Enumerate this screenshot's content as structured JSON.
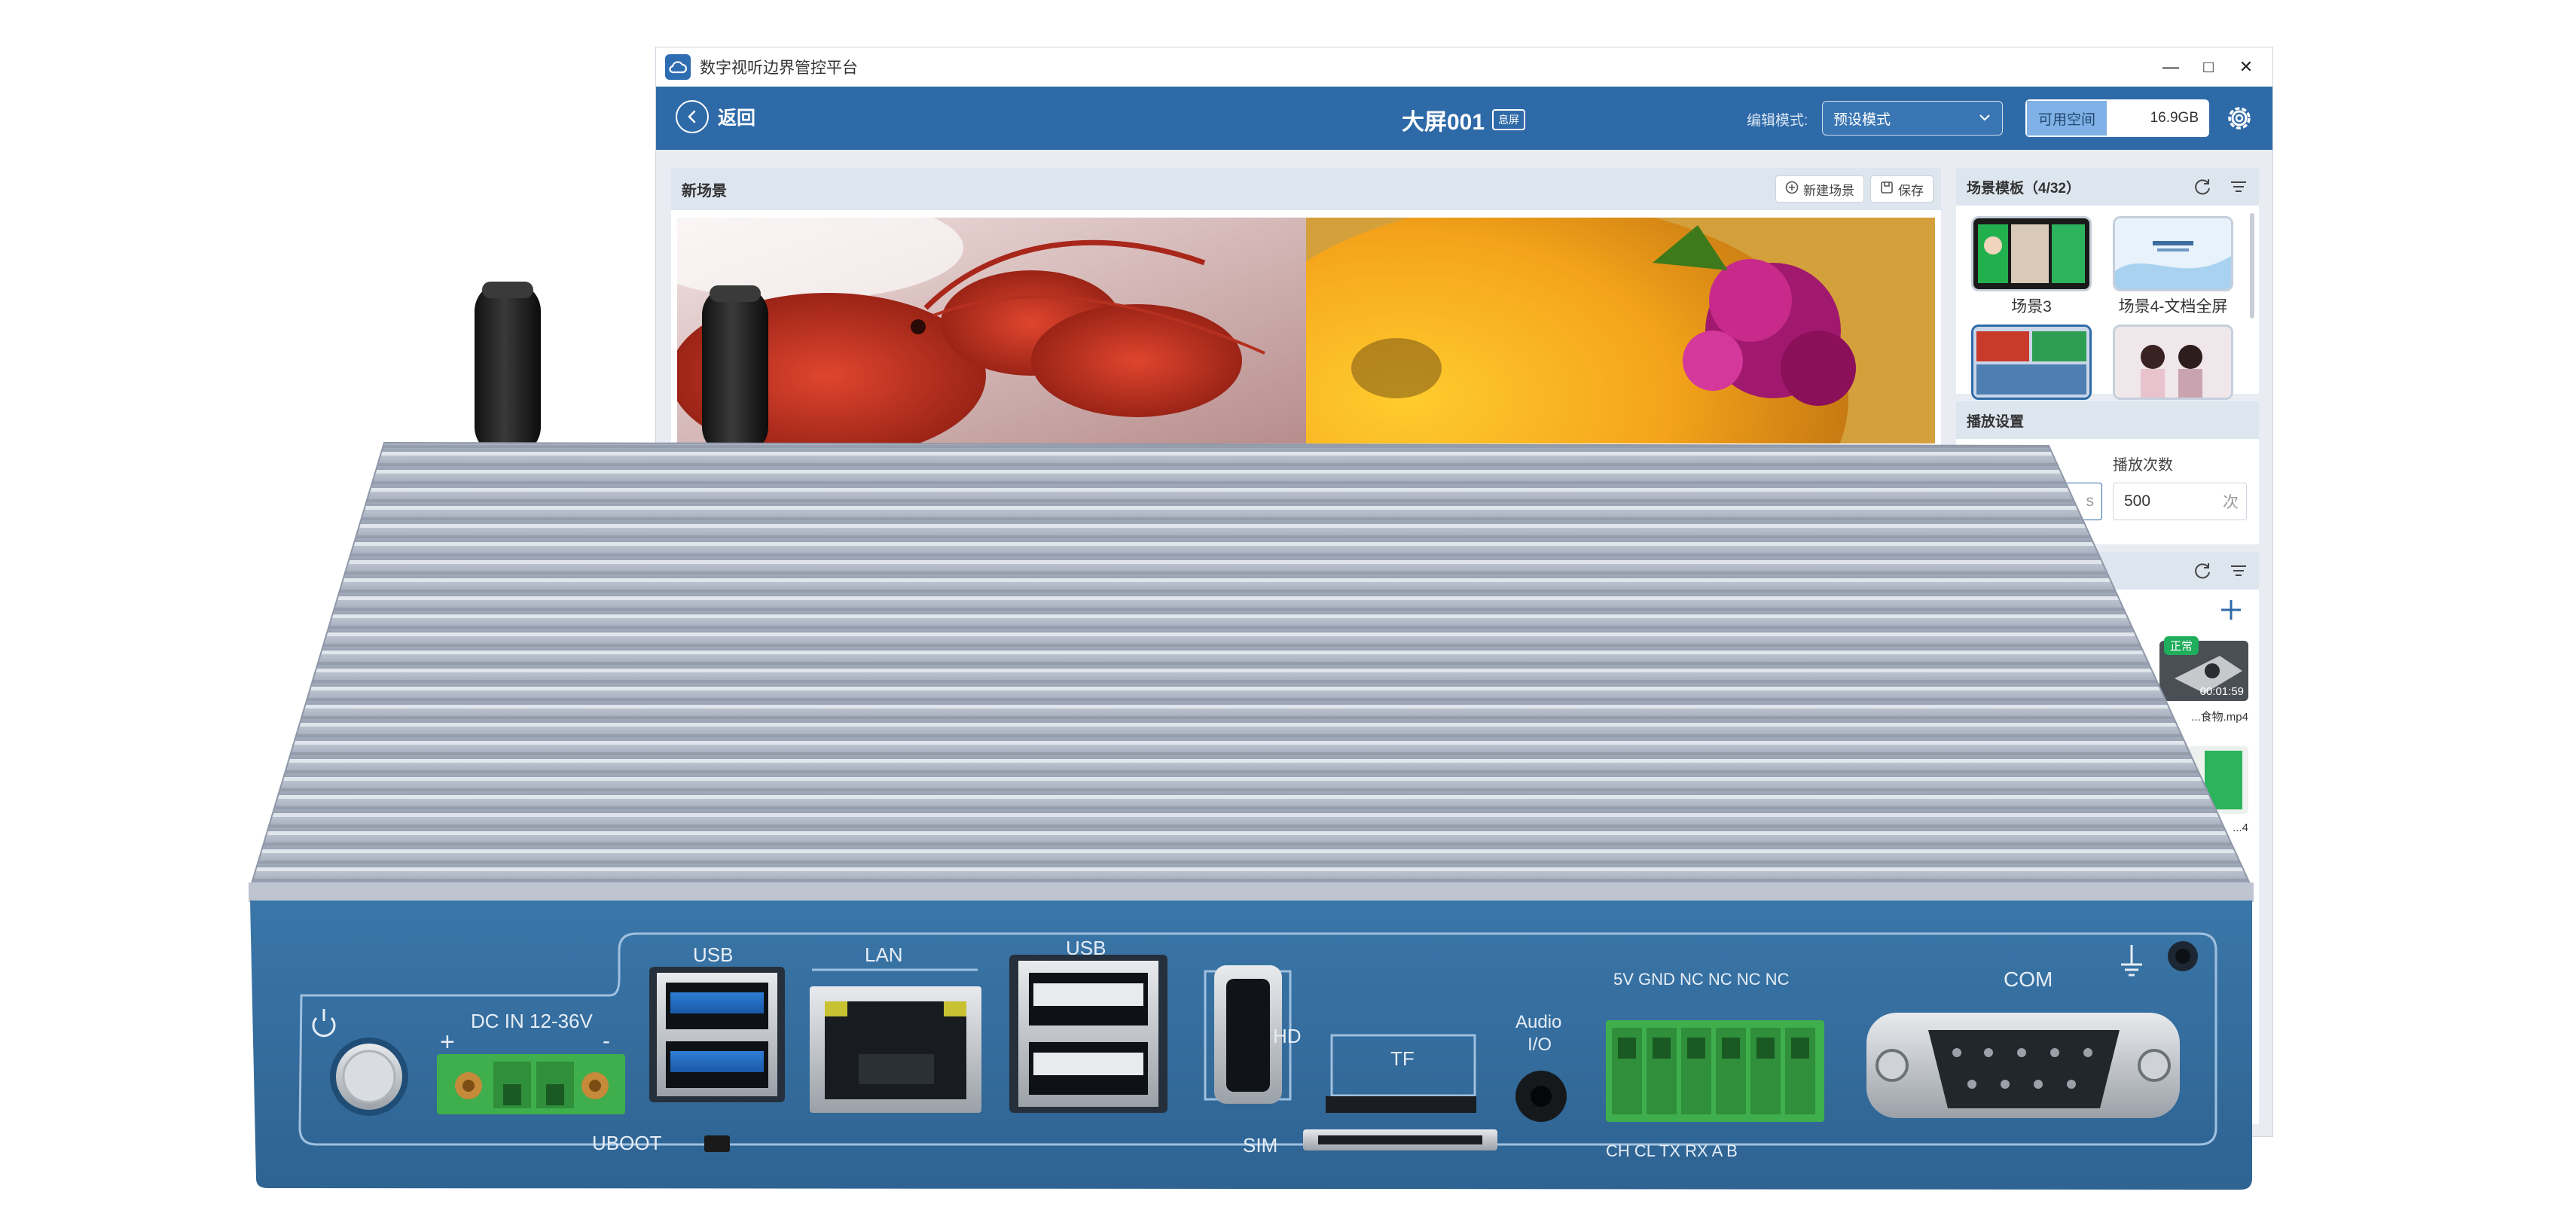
{
  "window": {
    "title": "数字视听边界管控平台",
    "controls": {
      "minimize": "—",
      "maximize": "□",
      "close": "✕"
    }
  },
  "header": {
    "back_label": "返回",
    "screen_name": "大屏001",
    "screen_badge": "息屏",
    "edit_mode_label": "编辑模式:",
    "edit_mode_value": "预设模式",
    "space_label": "可用空间",
    "space_value": "16.9GB",
    "icons": {
      "back": "chevron-left-icon",
      "dropdown": "chevron-down-icon",
      "settings": "gear-icon"
    }
  },
  "scene": {
    "title": "新场景",
    "new_button": "新建场景",
    "save_button": "保存",
    "tiles": [
      "lobster-photo",
      "flower-photo"
    ]
  },
  "templates": {
    "title": "场景模板（4/32）",
    "items": [
      {
        "label": "场景3"
      },
      {
        "label": "场景4-文档全屏"
      },
      {
        "label": ""
      },
      {
        "label": ""
      }
    ]
  },
  "playback": {
    "title": "播放设置",
    "duration_unit": "s",
    "count_label": "播放次数",
    "count_value": "500",
    "count_unit": "次"
  },
  "media": {
    "add_icon": "plus-icon",
    "items": [
      {
        "status": "正常",
        "duration": "00:01:59",
        "name": "...食物.mp4"
      },
      {
        "name": "...4"
      }
    ]
  },
  "device": {
    "labels": {
      "usb_left": "USB",
      "lan": "LAN",
      "usb_right": "USB",
      "dc_in": "DC IN 12-36V",
      "plus": "+",
      "minus": "-",
      "uboot": "UBOOT",
      "hd": "HD",
      "tf": "TF",
      "sim": "SIM",
      "audio": "Audio",
      "io": "I/O",
      "pins_top": "5V GND NC  NC  NC  NC",
      "pins_bottom": "CH  CL  TX  RX  A    B",
      "com": "COM"
    },
    "colors": {
      "panel": "#336d9e",
      "heatsink": "#aab2c0",
      "terminal": "#3fae4c"
    }
  }
}
